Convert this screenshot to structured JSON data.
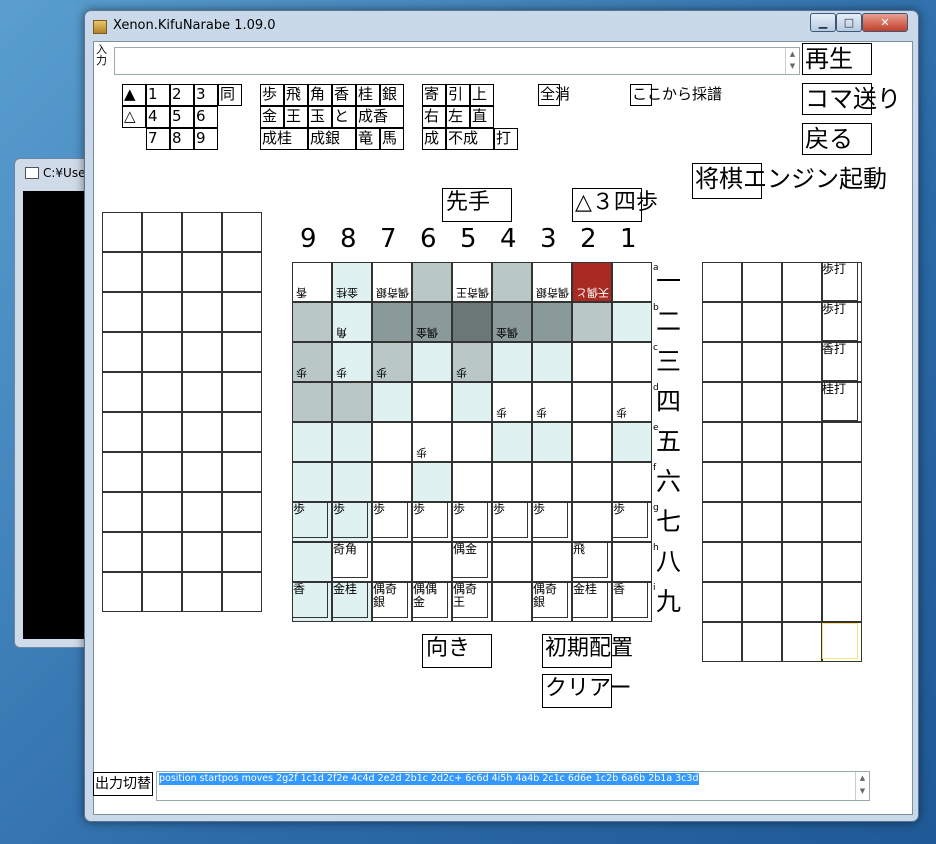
{
  "window": {
    "title": "Xenon.KifuNarabe 1.09.0"
  },
  "bg_window": {
    "title": "C:¥Use"
  },
  "input": {
    "label": "入力",
    "value": ""
  },
  "buttons": {
    "play": "再生",
    "step": "コマ送り",
    "back": "戻る",
    "engine": "将棋エンジン起動",
    "turn": "先手",
    "move": "△３四歩",
    "direction": "向き",
    "init": "初期配置",
    "clear": "クリアー",
    "output_toggle": "出力切替"
  },
  "row1": {
    "tri": "▲",
    "n1": "1",
    "n2": "2",
    "n3": "3",
    "same": "同"
  },
  "row2": {
    "tri": "△",
    "n4": "4",
    "n5": "5",
    "n6": "6"
  },
  "row3": {
    "n7": "7",
    "n8": "8",
    "n9": "9"
  },
  "pieces_btn": {
    "r1": [
      "歩",
      "飛",
      "角",
      "香",
      "桂",
      "銀"
    ],
    "r2": [
      "金",
      "王",
      "玉",
      "と",
      "成香"
    ],
    "r3": [
      "成桂",
      "成銀",
      "竜",
      "馬"
    ]
  },
  "moves_btn": {
    "r1": [
      "寄",
      "引",
      "上"
    ],
    "r2": [
      "右",
      "左",
      "直"
    ],
    "r3": [
      "成",
      "不成",
      "打"
    ]
  },
  "all_clear": "全消",
  "from_here": "ここから採譜",
  "files": [
    "9",
    "8",
    "7",
    "6",
    "5",
    "4",
    "3",
    "2",
    "1"
  ],
  "ranks": [
    "一",
    "二",
    "三",
    "四",
    "五",
    "六",
    "七",
    "八",
    "九"
  ],
  "rank_letters": [
    "a",
    "b",
    "c",
    "d",
    "e",
    "f",
    "g",
    "h",
    "i"
  ],
  "hand_right": [
    "歩打",
    "歩打",
    "香打",
    "桂打"
  ],
  "board_sente": {
    "g": [
      "歩",
      "歩",
      "歩",
      "歩",
      "歩",
      "歩",
      "歩",
      "",
      "歩"
    ],
    "h": [
      "",
      "奇角",
      "",
      "",
      "偶金",
      "",
      "",
      "飛",
      ""
    ],
    "i": [
      "香",
      "金桂",
      "偶奇銀",
      "偶偶金",
      "偶奇王",
      "",
      "偶奇銀",
      "金桂",
      "香"
    ]
  },
  "board_gote": {
    "a": [
      "香",
      "金桂",
      "偶奇銀",
      "",
      "偶奇王",
      "",
      "偶奇銀",
      "天偶と",
      ""
    ],
    "b": [
      "",
      "角",
      "",
      "偶金",
      "",
      "偶金",
      "",
      "",
      ""
    ],
    "c": [
      "歩",
      "歩",
      "歩",
      "",
      "歩",
      "",
      "",
      "",
      ""
    ],
    "d": [
      "",
      "",
      "",
      "",
      "",
      "歩",
      "歩",
      "",
      "歩"
    ],
    "e": [
      "",
      "",
      "",
      "歩",
      "",
      "",
      "",
      "",
      ""
    ]
  },
  "output": {
    "value": "position startpos moves 2g2f 1c1d 2f2e 4c4d 2e2d 2b1c 2d2c+ 6c6d 4i5h 4a4b 2c1c 6d6e 1c2b 6a6b 2b1a 3c3d"
  },
  "colors": {
    "pale": "#e0f1f2",
    "gray": "#b9c7c7",
    "mid": "#8a9999",
    "dark": "#6b7676",
    "red": "#a92a22"
  }
}
